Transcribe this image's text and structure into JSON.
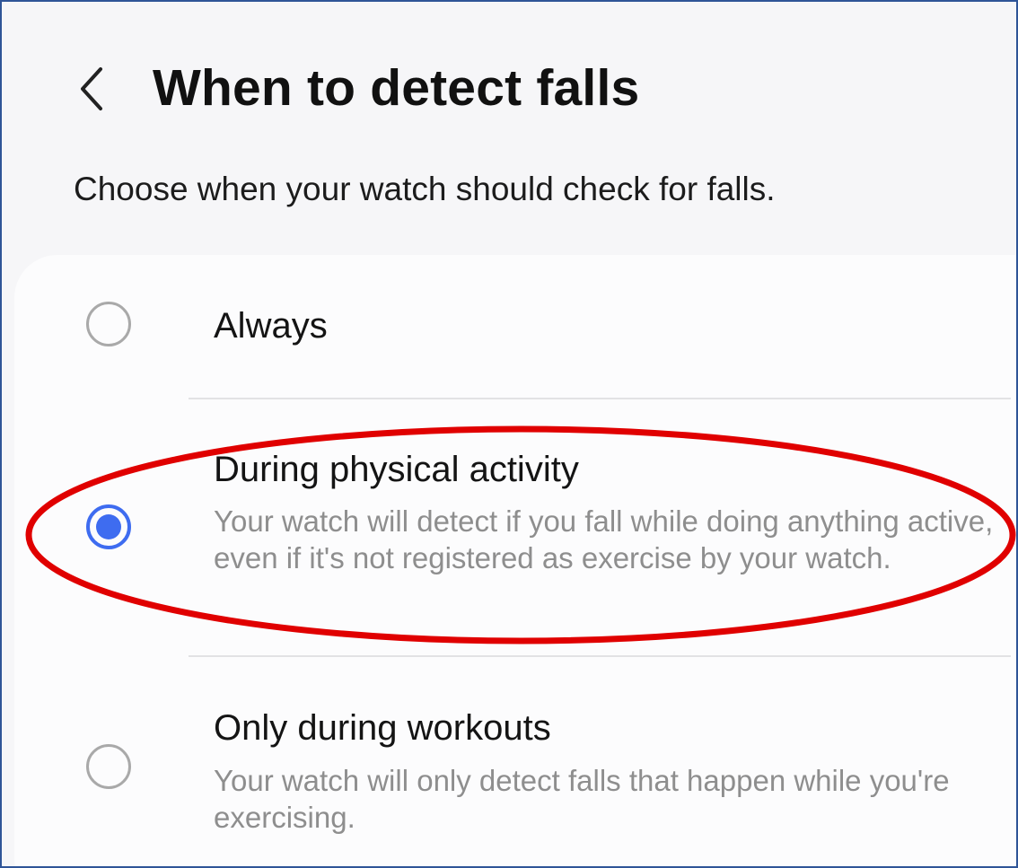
{
  "header": {
    "back_icon": "chevron-left-icon",
    "title": "When to detect falls"
  },
  "subtitle": "Choose when your watch should check for falls.",
  "options": [
    {
      "title": "Always",
      "description": "",
      "selected": false
    },
    {
      "title": "During physical activity",
      "description": "Your watch will detect if you fall while doing anything active, even if it's not registered as exercise by your watch.",
      "selected": true
    },
    {
      "title": "Only during workouts",
      "description": "Your watch will only detect falls that happen while you're exercising.",
      "selected": false
    }
  ],
  "colors": {
    "accent": "#3e6cf0",
    "annotation": "#e00000",
    "frame_border": "#2f5597",
    "background": "#f6f6f8",
    "card": "#fcfcfd"
  }
}
